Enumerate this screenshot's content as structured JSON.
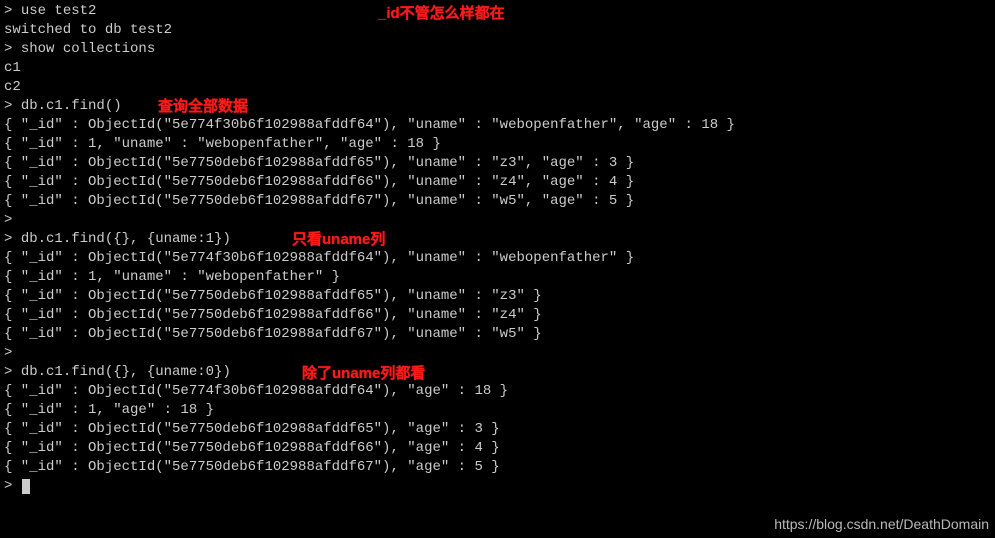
{
  "prompt": ">",
  "cmd_use": "use test2",
  "out_switched": "switched to db test2",
  "cmd_show": "show collections",
  "out_c1": "c1",
  "out_c2": "c2",
  "cmd_find1": "db.c1.find()",
  "cmd_find2": "db.c1.find({}, {uname:1})",
  "cmd_find3": "db.c1.find({}, {uname:0})",
  "r1a": "{ \"_id\" : ObjectId(\"5e774f30b6f102988afddf64\"), \"uname\" : \"webopenfather\", \"age\" : 18 }",
  "r1b": "{ \"_id\" : 1, \"uname\" : \"webopenfather\", \"age\" : 18 }",
  "r1c": "{ \"_id\" : ObjectId(\"5e7750deb6f102988afddf65\"), \"uname\" : \"z3\", \"age\" : 3 }",
  "r1d": "{ \"_id\" : ObjectId(\"5e7750deb6f102988afddf66\"), \"uname\" : \"z4\", \"age\" : 4 }",
  "r1e": "{ \"_id\" : ObjectId(\"5e7750deb6f102988afddf67\"), \"uname\" : \"w5\", \"age\" : 5 }",
  "r2a": "{ \"_id\" : ObjectId(\"5e774f30b6f102988afddf64\"), \"uname\" : \"webopenfather\" }",
  "r2b": "{ \"_id\" : 1, \"uname\" : \"webopenfather\" }",
  "r2c": "{ \"_id\" : ObjectId(\"5e7750deb6f102988afddf65\"), \"uname\" : \"z3\" }",
  "r2d": "{ \"_id\" : ObjectId(\"5e7750deb6f102988afddf66\"), \"uname\" : \"z4\" }",
  "r2e": "{ \"_id\" : ObjectId(\"5e7750deb6f102988afddf67\"), \"uname\" : \"w5\" }",
  "r3a": "{ \"_id\" : ObjectId(\"5e774f30b6f102988afddf64\"), \"age\" : 18 }",
  "r3b": "{ \"_id\" : 1, \"age\" : 18 }",
  "r3c": "{ \"_id\" : ObjectId(\"5e7750deb6f102988afddf65\"), \"age\" : 3 }",
  "r3d": "{ \"_id\" : ObjectId(\"5e7750deb6f102988afddf66\"), \"age\" : 4 }",
  "r3e": "{ \"_id\" : ObjectId(\"5e7750deb6f102988afddf67\"), \"age\" : 5 }",
  "ann_top": "_id不管怎么样都在",
  "ann_find_all": "查询全部数据",
  "ann_uname_only": "只看uname列",
  "ann_except_uname": "除了uname列都看",
  "watermark": "https://blog.csdn.net/DeathDomain"
}
